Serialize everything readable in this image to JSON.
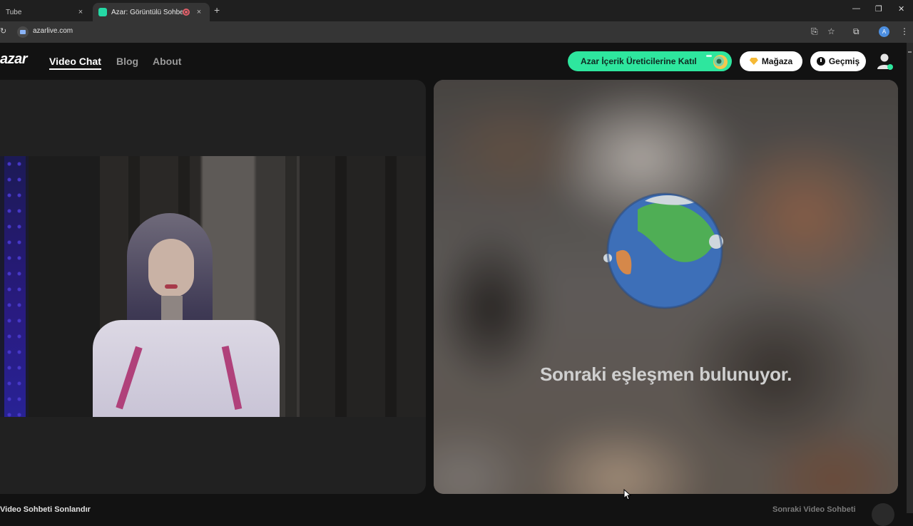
{
  "browser": {
    "tabs": [
      {
        "title": "Tube",
        "active": false
      },
      {
        "title": "Azar: Görüntülü Sohbet & Y",
        "active": true
      }
    ],
    "close_glyph": "×",
    "new_tab_glyph": "+",
    "url": "azarlive.com",
    "profile_initial": "A",
    "window_controls": {
      "minimize": "—",
      "restore": "❐",
      "close": "✕"
    }
  },
  "header": {
    "logo": "azar",
    "nav": [
      {
        "label": "Video Chat",
        "active": true
      },
      {
        "label": "Blog",
        "active": false
      },
      {
        "label": "About",
        "active": false
      }
    ],
    "creator_button": "Azar İçerik Üreticilerine Katıl",
    "shop_button": "Mağaza",
    "history_button": "Geçmiş"
  },
  "matching": {
    "status_text": "Sonraki eşleşmen bulunuyor."
  },
  "footer": {
    "end_chat": "Video Sohbeti Sonlandır",
    "next_chat": "Sonraki Video Sohbeti"
  },
  "colors": {
    "accent_green": "#2ee69e",
    "background": "#121212",
    "panel": "#212121"
  },
  "icons": {
    "reload": "reload-icon",
    "site_info": "video-call-icon",
    "install": "install-app-icon",
    "bookmark": "star-icon",
    "extensions": "puzzle-icon",
    "menu": "kebab-menu-icon",
    "shop": "diamond-icon",
    "history": "clock-icon",
    "avatar": "user-avatar-icon",
    "globe": "globe-icon"
  }
}
